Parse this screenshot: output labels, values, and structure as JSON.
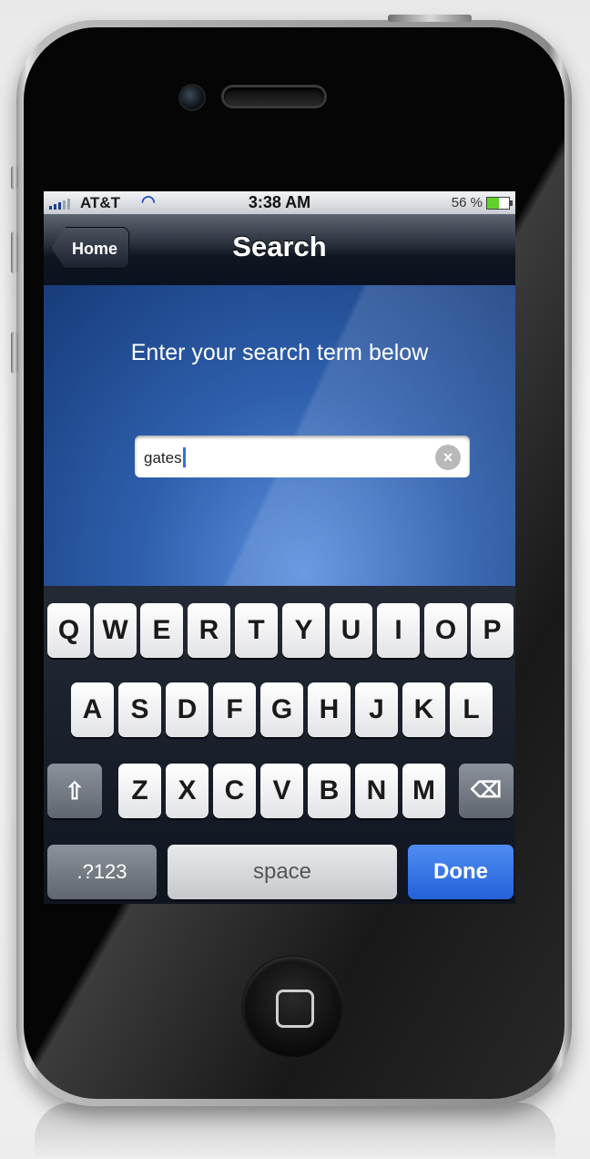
{
  "status_bar": {
    "carrier": "AT&T",
    "time": "3:38 AM",
    "battery_percent": "56 %",
    "battery_level": 0.56,
    "wifi_icon": "wifi-icon",
    "signal_icon": "signal-bars-icon"
  },
  "nav": {
    "back_label": "Home",
    "title": "Search"
  },
  "content": {
    "prompt": "Enter your search term below",
    "search_value": "gates",
    "clear_icon": "clear-circle-icon"
  },
  "keyboard": {
    "row1": [
      "Q",
      "W",
      "E",
      "R",
      "T",
      "Y",
      "U",
      "I",
      "O",
      "P"
    ],
    "row2": [
      "A",
      "S",
      "D",
      "F",
      "G",
      "H",
      "J",
      "K",
      "L"
    ],
    "row3": [
      "Z",
      "X",
      "C",
      "V",
      "B",
      "N",
      "M"
    ],
    "shift_icon": "shift-arrow-icon",
    "delete_icon": "backspace-icon",
    "numbers_label": ".?123",
    "space_label": "space",
    "done_label": "Done"
  },
  "colors": {
    "done_key": "#2461d8",
    "content_bg": "#2e5fad"
  }
}
